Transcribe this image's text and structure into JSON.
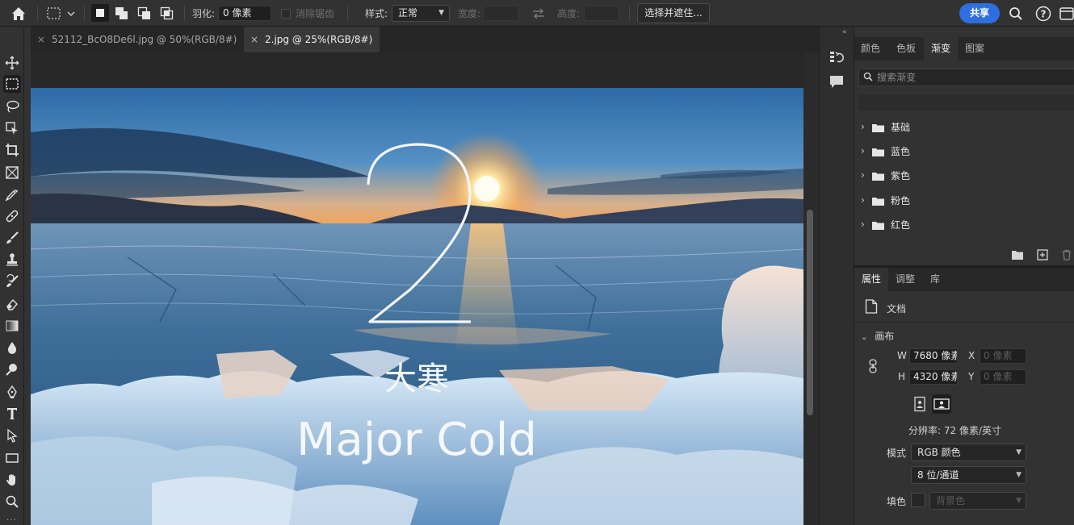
{
  "options_bar": {
    "feather_label": "羽化:",
    "feather_value": "0 像素",
    "antialias_label": "消除锯齿",
    "style_label": "样式:",
    "style_value": "正常",
    "width_label": "宽度:",
    "height_label": "高度:",
    "select_mask_button": "选择并遮住...",
    "share_button": "共享"
  },
  "tabs": [
    {
      "label": "52112_BcO8De6l.jpg @ 50%(RGB/8#)",
      "active": false
    },
    {
      "label": "2.jpg @ 25%(RGB/8#)",
      "active": true
    }
  ],
  "tools": [
    "move-tool",
    "marquee-tool",
    "lasso-tool",
    "object-select-tool",
    "crop-tool",
    "frame-tool",
    "eyedropper-tool",
    "healing-brush-tool",
    "brush-tool",
    "clone-stamp-tool",
    "history-brush-tool",
    "eraser-tool",
    "gradient-tool",
    "blur-tool",
    "dodge-tool",
    "pen-tool",
    "type-tool",
    "path-select-tool",
    "shape-tool",
    "hand-tool",
    "zoom-tool"
  ],
  "canvas_image": {
    "number": "2",
    "chinese_title": "大寒",
    "english_title": "Major Cold"
  },
  "upper_panel": {
    "tabs": [
      "颜色",
      "色板",
      "渐变",
      "图案"
    ],
    "active_tab": "渐变",
    "search_placeholder": "搜索渐变",
    "folders": [
      "基础",
      "蓝色",
      "紫色",
      "粉色",
      "红色"
    ]
  },
  "properties_panel": {
    "tabs": [
      "属性",
      "调整",
      "库"
    ],
    "active_tab": "属性",
    "doc_label": "文档",
    "canvas_section": "画布",
    "w_label": "W",
    "w_value": "7680 像素",
    "h_label": "H",
    "h_value": "4320 像素",
    "x_label": "X",
    "x_placeholder": "0 像素",
    "y_label": "Y",
    "y_placeholder": "0 像素",
    "resolution": "分辨率: 72 像素/英寸",
    "mode_label": "模式",
    "mode_value": "RGB 颜色",
    "bit_value": "8 位/通道",
    "fill_label": "填色",
    "fill_value": "背景色"
  },
  "colors": {
    "accent": "#2d6fe0",
    "ui_dark": "#323232",
    "canvas_bg": "#282828"
  }
}
